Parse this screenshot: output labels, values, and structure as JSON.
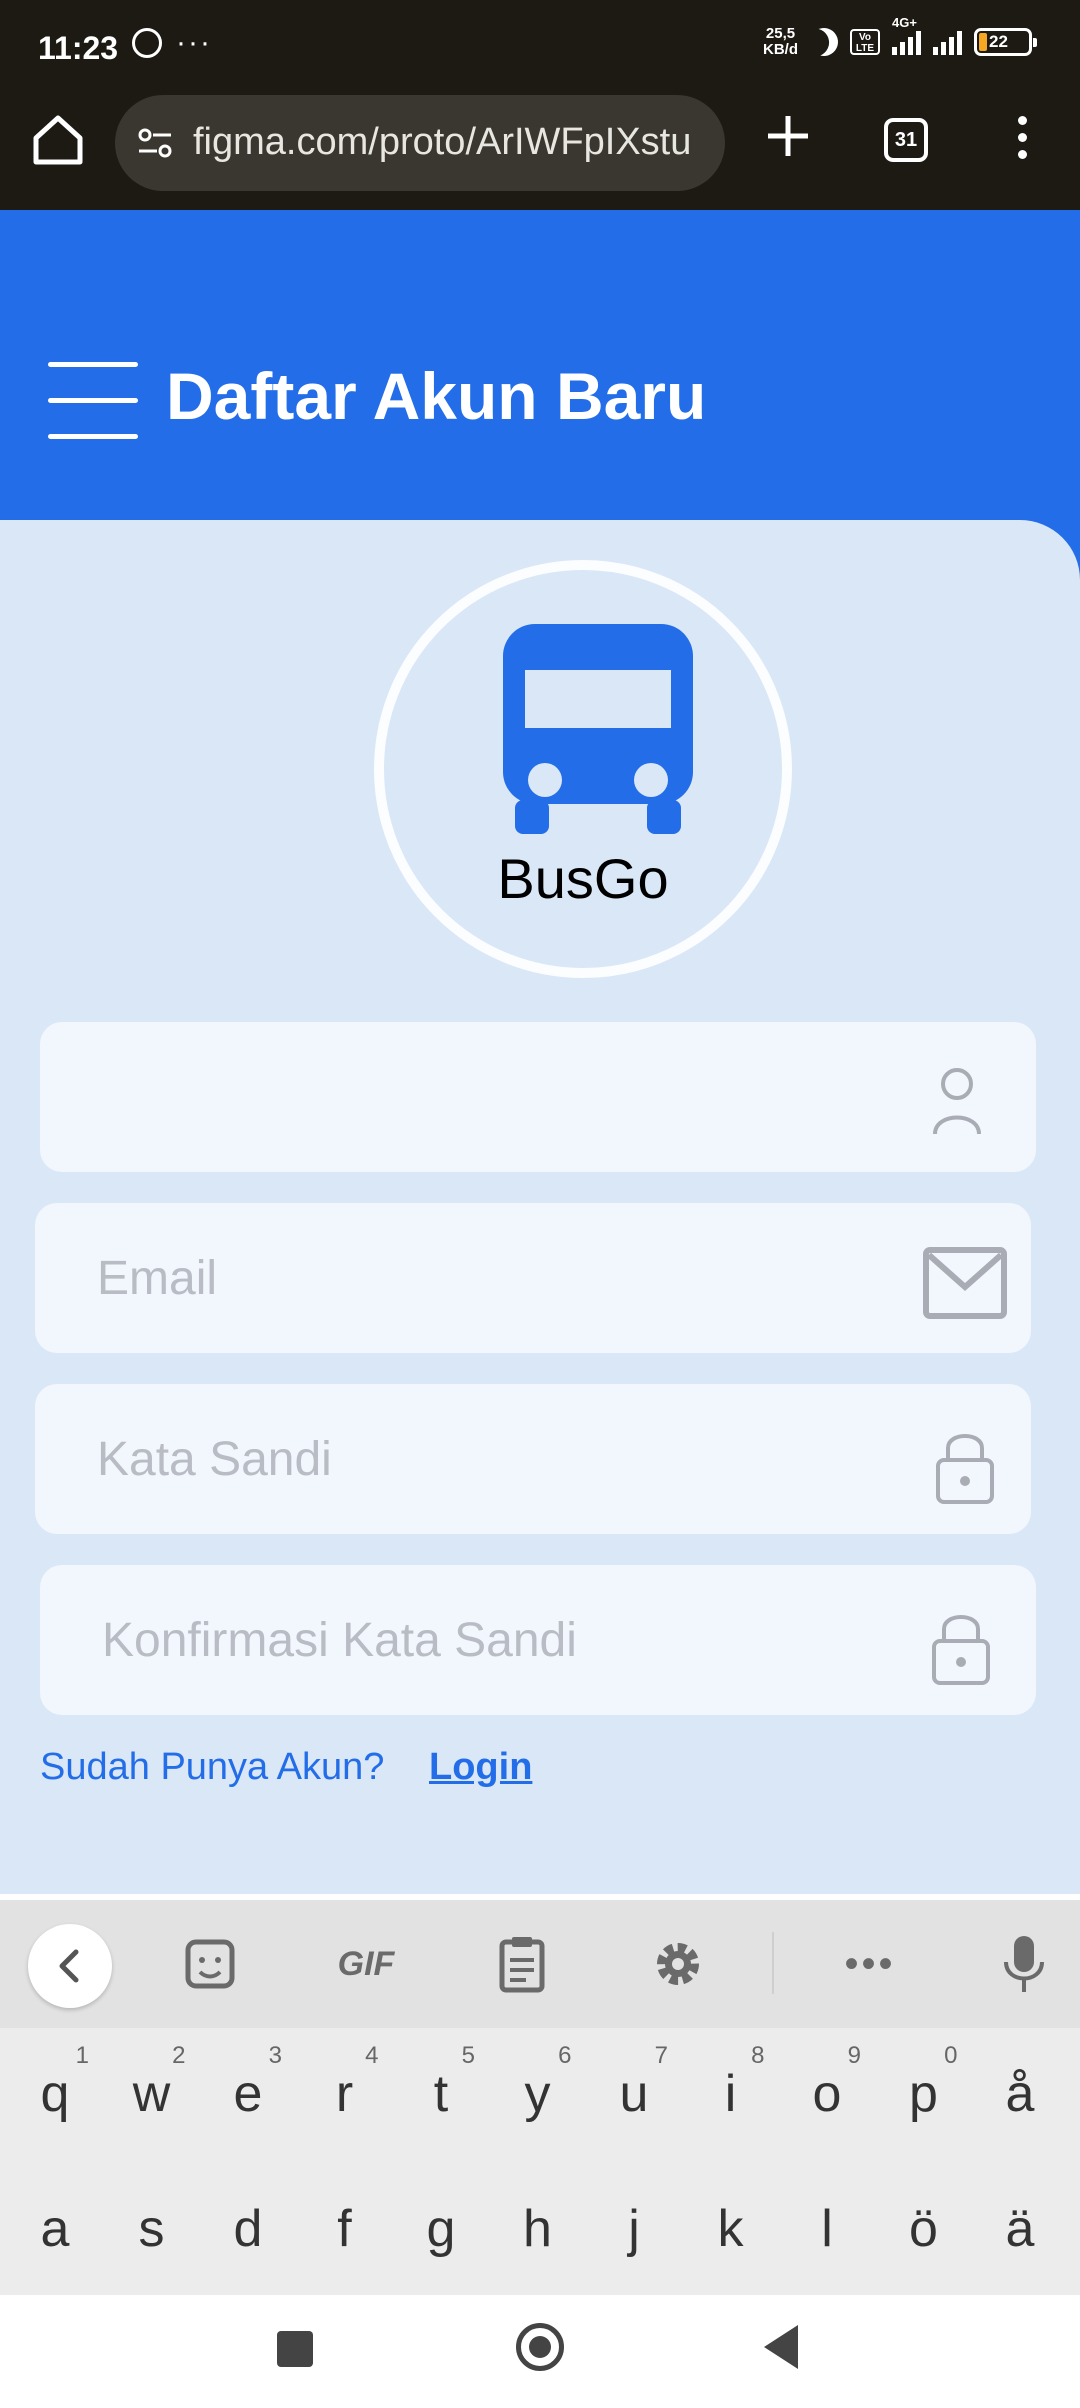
{
  "status_bar": {
    "time": "11:23",
    "speed_value": "25,5",
    "speed_unit": "KB/d",
    "network_label": "4G+",
    "lte_badge": "Vo LTE",
    "battery": "22"
  },
  "browser": {
    "url": "figma.com/proto/ArIWFpIXstu",
    "tab_count": "31"
  },
  "header": {
    "title": "Daftar Akun Baru"
  },
  "logo": {
    "brand": "BusGo"
  },
  "form": {
    "name_placeholder": "",
    "email_placeholder": "Email",
    "password_placeholder": "Kata Sandi",
    "confirm_placeholder": "Konfirmasi Kata Sandi"
  },
  "login_prompt": {
    "question": "Sudah Punya Akun?",
    "link_label": "Login"
  },
  "keyboard": {
    "toolbar": {
      "gif_label": "GIF",
      "more_label": "•••"
    },
    "row1": [
      {
        "ch": "q",
        "num": "1"
      },
      {
        "ch": "w",
        "num": "2"
      },
      {
        "ch": "e",
        "num": "3"
      },
      {
        "ch": "r",
        "num": "4"
      },
      {
        "ch": "t",
        "num": "5"
      },
      {
        "ch": "y",
        "num": "6"
      },
      {
        "ch": "u",
        "num": "7"
      },
      {
        "ch": "i",
        "num": "8"
      },
      {
        "ch": "o",
        "num": "9"
      },
      {
        "ch": "p",
        "num": "0"
      },
      {
        "ch": "å",
        "num": ""
      }
    ],
    "row2": [
      {
        "ch": "a"
      },
      {
        "ch": "s"
      },
      {
        "ch": "d"
      },
      {
        "ch": "f"
      },
      {
        "ch": "g"
      },
      {
        "ch": "h"
      },
      {
        "ch": "j"
      },
      {
        "ch": "k"
      },
      {
        "ch": "l"
      },
      {
        "ch": "ö"
      },
      {
        "ch": "ä"
      }
    ]
  },
  "colors": {
    "primary": "#236ee8",
    "panel": "#d9e7f7",
    "field": "#f2f6fd",
    "chrome": "#1d1a14"
  }
}
